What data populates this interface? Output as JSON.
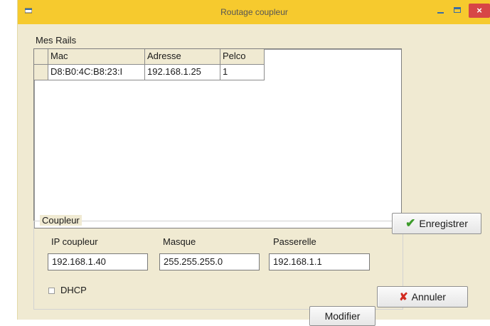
{
  "window": {
    "title": "Routage coupleur",
    "close_glyph": "×",
    "icons": {
      "system": "app-icon",
      "minimize": "minimize-icon",
      "maximize": "maximize-icon",
      "close": "close-icon"
    }
  },
  "rails": {
    "label": "Mes Rails",
    "columns": [
      "Mac",
      "Adresse",
      "Pelco"
    ],
    "rows": [
      {
        "mac": "D8:B0:4C:B8:23:I",
        "adresse": "192.168.1.25",
        "pelco": "1"
      }
    ]
  },
  "coupleur": {
    "label": "Coupleur",
    "ip_label": "IP coupleur",
    "ip_value": "192.168.1.40",
    "masque_label": "Masque",
    "masque_value": "255.255.255.0",
    "passerelle_label": "Passerelle",
    "passerelle_value": "192.168.1.1",
    "dhcp_label": "DHCP",
    "dhcp_checked": false
  },
  "buttons": {
    "enregistrer": "Enregistrer",
    "modifier": "Modifier",
    "annuler": "Annuler",
    "check_glyph": "✔",
    "x_glyph": "✘"
  },
  "colors": {
    "titlebar": "#f6ca2e",
    "close_button": "#d74646",
    "client": "#f0ead2"
  }
}
